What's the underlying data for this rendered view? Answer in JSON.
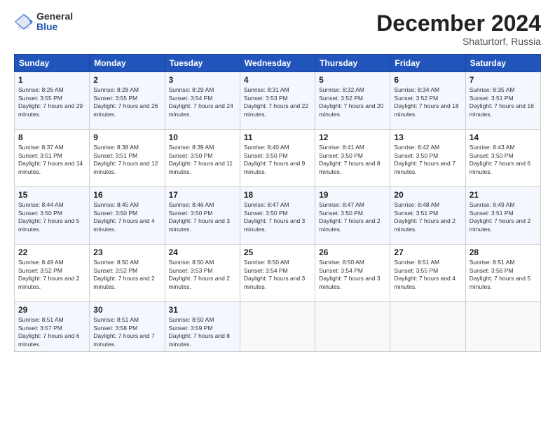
{
  "logo": {
    "general": "General",
    "blue": "Blue"
  },
  "title": "December 2024",
  "location": "Shaturtorf, Russia",
  "days_header": [
    "Sunday",
    "Monday",
    "Tuesday",
    "Wednesday",
    "Thursday",
    "Friday",
    "Saturday"
  ],
  "weeks": [
    [
      {
        "day": "1",
        "sunrise": "8:26 AM",
        "sunset": "3:55 PM",
        "daylight": "7 hours and 29 minutes."
      },
      {
        "day": "2",
        "sunrise": "8:28 AM",
        "sunset": "3:55 PM",
        "daylight": "7 hours and 26 minutes."
      },
      {
        "day": "3",
        "sunrise": "8:29 AM",
        "sunset": "3:54 PM",
        "daylight": "7 hours and 24 minutes."
      },
      {
        "day": "4",
        "sunrise": "8:31 AM",
        "sunset": "3:53 PM",
        "daylight": "7 hours and 22 minutes."
      },
      {
        "day": "5",
        "sunrise": "8:32 AM",
        "sunset": "3:52 PM",
        "daylight": "7 hours and 20 minutes."
      },
      {
        "day": "6",
        "sunrise": "8:34 AM",
        "sunset": "3:52 PM",
        "daylight": "7 hours and 18 minutes."
      },
      {
        "day": "7",
        "sunrise": "8:35 AM",
        "sunset": "3:51 PM",
        "daylight": "7 hours and 16 minutes."
      }
    ],
    [
      {
        "day": "8",
        "sunrise": "8:37 AM",
        "sunset": "3:51 PM",
        "daylight": "7 hours and 14 minutes."
      },
      {
        "day": "9",
        "sunrise": "8:38 AM",
        "sunset": "3:51 PM",
        "daylight": "7 hours and 12 minutes."
      },
      {
        "day": "10",
        "sunrise": "8:39 AM",
        "sunset": "3:50 PM",
        "daylight": "7 hours and 11 minutes."
      },
      {
        "day": "11",
        "sunrise": "8:40 AM",
        "sunset": "3:50 PM",
        "daylight": "7 hours and 9 minutes."
      },
      {
        "day": "12",
        "sunrise": "8:41 AM",
        "sunset": "3:50 PM",
        "daylight": "7 hours and 8 minutes."
      },
      {
        "day": "13",
        "sunrise": "8:42 AM",
        "sunset": "3:50 PM",
        "daylight": "7 hours and 7 minutes."
      },
      {
        "day": "14",
        "sunrise": "8:43 AM",
        "sunset": "3:50 PM",
        "daylight": "7 hours and 6 minutes."
      }
    ],
    [
      {
        "day": "15",
        "sunrise": "8:44 AM",
        "sunset": "3:50 PM",
        "daylight": "7 hours and 5 minutes."
      },
      {
        "day": "16",
        "sunrise": "8:45 AM",
        "sunset": "3:50 PM",
        "daylight": "7 hours and 4 minutes."
      },
      {
        "day": "17",
        "sunrise": "8:46 AM",
        "sunset": "3:50 PM",
        "daylight": "7 hours and 3 minutes."
      },
      {
        "day": "18",
        "sunrise": "8:47 AM",
        "sunset": "3:50 PM",
        "daylight": "7 hours and 3 minutes."
      },
      {
        "day": "19",
        "sunrise": "8:47 AM",
        "sunset": "3:50 PM",
        "daylight": "7 hours and 2 minutes."
      },
      {
        "day": "20",
        "sunrise": "8:48 AM",
        "sunset": "3:51 PM",
        "daylight": "7 hours and 2 minutes."
      },
      {
        "day": "21",
        "sunrise": "8:49 AM",
        "sunset": "3:51 PM",
        "daylight": "7 hours and 2 minutes."
      }
    ],
    [
      {
        "day": "22",
        "sunrise": "8:49 AM",
        "sunset": "3:52 PM",
        "daylight": "7 hours and 2 minutes."
      },
      {
        "day": "23",
        "sunrise": "8:50 AM",
        "sunset": "3:52 PM",
        "daylight": "7 hours and 2 minutes."
      },
      {
        "day": "24",
        "sunrise": "8:50 AM",
        "sunset": "3:53 PM",
        "daylight": "7 hours and 2 minutes."
      },
      {
        "day": "25",
        "sunrise": "8:50 AM",
        "sunset": "3:54 PM",
        "daylight": "7 hours and 3 minutes."
      },
      {
        "day": "26",
        "sunrise": "8:50 AM",
        "sunset": "3:54 PM",
        "daylight": "7 hours and 3 minutes."
      },
      {
        "day": "27",
        "sunrise": "8:51 AM",
        "sunset": "3:55 PM",
        "daylight": "7 hours and 4 minutes."
      },
      {
        "day": "28",
        "sunrise": "8:51 AM",
        "sunset": "3:56 PM",
        "daylight": "7 hours and 5 minutes."
      }
    ],
    [
      {
        "day": "29",
        "sunrise": "8:51 AM",
        "sunset": "3:57 PM",
        "daylight": "7 hours and 6 minutes."
      },
      {
        "day": "30",
        "sunrise": "8:51 AM",
        "sunset": "3:58 PM",
        "daylight": "7 hours and 7 minutes."
      },
      {
        "day": "31",
        "sunrise": "8:50 AM",
        "sunset": "3:59 PM",
        "daylight": "7 hours and 8 minutes."
      },
      null,
      null,
      null,
      null
    ]
  ]
}
